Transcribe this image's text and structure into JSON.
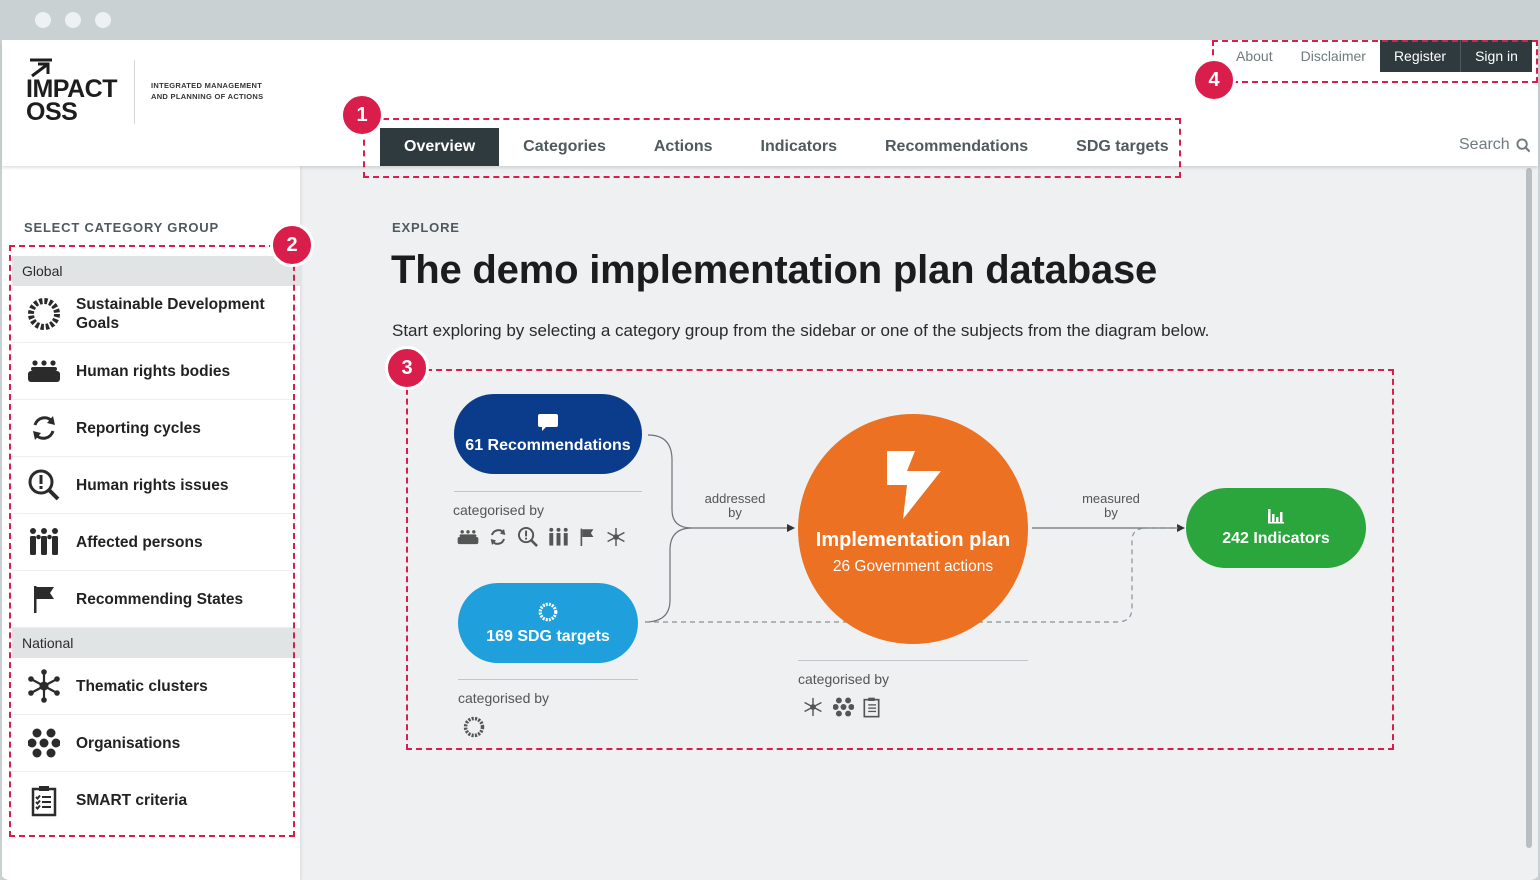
{
  "brand": {
    "logo_line1": "IMPACT",
    "logo_line2": "OSS",
    "tagline_line1": "INTEGRATED MANAGEMENT",
    "tagline_line2": "AND PLANNING OF ACTIONS"
  },
  "nav": {
    "items": [
      {
        "label": "Overview",
        "active": true
      },
      {
        "label": "Categories"
      },
      {
        "label": "Actions"
      },
      {
        "label": "Indicators"
      },
      {
        "label": "Recommendations"
      },
      {
        "label": "SDG targets"
      }
    ],
    "search_label": "Search"
  },
  "top_links": {
    "about": "About",
    "disclaimer": "Disclaimer",
    "register": "Register",
    "sign_in": "Sign in"
  },
  "sidebar": {
    "heading": "SELECT CATEGORY GROUP",
    "groups": [
      {
        "label": "Global"
      },
      {
        "label": "National"
      }
    ],
    "items": [
      {
        "label": "Sustainable Development Goals",
        "icon": "sdg-wheel-icon"
      },
      {
        "label": "Human rights bodies",
        "icon": "assembly-icon"
      },
      {
        "label": "Reporting cycles",
        "icon": "cycle-icon"
      },
      {
        "label": "Human rights issues",
        "icon": "issue-magnifier-icon"
      },
      {
        "label": "Affected persons",
        "icon": "people-icon"
      },
      {
        "label": "Recommending States",
        "icon": "flag-icon"
      },
      {
        "label": "Thematic clusters",
        "icon": "cluster-icon"
      },
      {
        "label": "Organisations",
        "icon": "organisations-icon"
      },
      {
        "label": "SMART criteria",
        "icon": "checklist-icon"
      }
    ]
  },
  "main": {
    "eyebrow": "EXPLORE",
    "title": "The demo implementation plan database",
    "intro": "Start exploring by selecting a category group from the sidebar or one of the subjects from the diagram below."
  },
  "diagram": {
    "recommendations": "61 Recommendations",
    "sdg_targets": "169 SDG targets",
    "plan_title": "Implementation plan",
    "plan_subtitle": "26 Government actions",
    "indicators": "242 Indicators",
    "addressed_by_1": "addressed",
    "addressed_by_2": "by",
    "measured_by_1": "measured",
    "measured_by_2": "by",
    "categorised_by": "categorised by",
    "colors": {
      "recommendations": "#0b3c8c",
      "sdg": "#1f9fdc",
      "plan": "#ec7123",
      "indicators": "#2aa63d"
    }
  },
  "annotations": [
    "1",
    "2",
    "3",
    "4"
  ]
}
